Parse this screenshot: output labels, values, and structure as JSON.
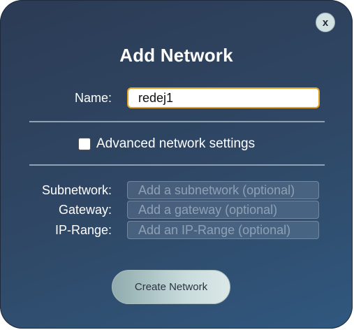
{
  "dialog": {
    "title": "Add Network",
    "close_label": "x"
  },
  "name_field": {
    "label": "Name:",
    "value": "redej1"
  },
  "advanced": {
    "label": "Advanced network settings",
    "checked": false
  },
  "subnetwork": {
    "label": "Subnetwork:",
    "placeholder": "Add a subnetwork (optional)"
  },
  "gateway": {
    "label": "Gateway:",
    "placeholder": "Add a gateway (optional)"
  },
  "ip_range": {
    "label": "IP-Range:",
    "placeholder": "Add an IP-Range (optional)"
  },
  "create_button": {
    "label": "Create Network"
  },
  "colors": {
    "focus_border": "#e3a324",
    "modal_bg_start": "#2c3b55",
    "modal_bg_end": "#30587f",
    "button_bg": "#c7dadb"
  }
}
